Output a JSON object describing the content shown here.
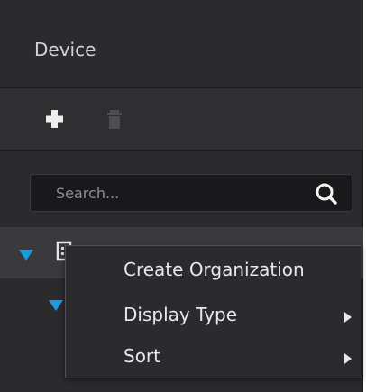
{
  "panel": {
    "title": "Device"
  },
  "toolbar": {
    "add_icon": "plus-icon",
    "delete_icon": "trash-icon"
  },
  "search": {
    "placeholder": "Search...",
    "icon": "search-icon"
  },
  "tree": {
    "node_label": ""
  },
  "context_menu": {
    "items": [
      {
        "label": "Create Organization",
        "has_submenu": false
      },
      {
        "label": "Display Type",
        "has_submenu": true
      },
      {
        "label": "Sort",
        "has_submenu": true
      }
    ]
  },
  "colors": {
    "accent": "#1e9be0",
    "panel_bg": "#2b2b2e",
    "menu_bg": "#2b2b2e",
    "text": "#e8e8ea"
  }
}
